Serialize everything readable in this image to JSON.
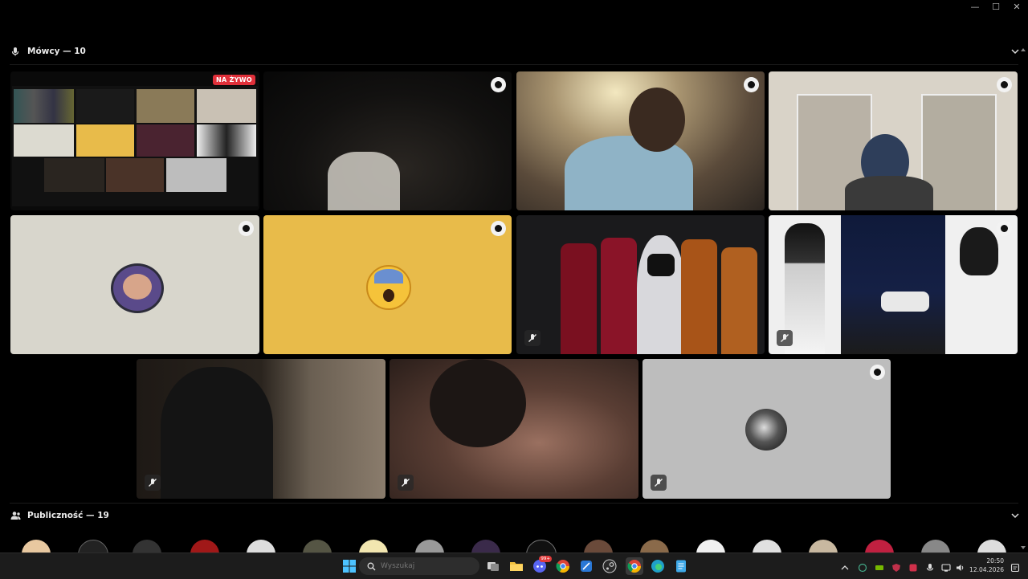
{
  "window": {
    "minimize_label": "—",
    "maximize_label": "☐",
    "close_label": "✕"
  },
  "speakers": {
    "title": "Mówcy — 10",
    "live_badge": "NA ŻYWO"
  },
  "audience": {
    "title": "Publiczność — 19",
    "count_avatars": 19
  },
  "taskbar": {
    "search_placeholder": "Wyszukaj",
    "time": "20:50",
    "date": "12.04.2026",
    "discord_badge": "99+"
  },
  "colors": {
    "background": "#000000",
    "tile_gray": "#d8d6cc",
    "tile_yellow": "#e8bb4a",
    "tile_silver": "#bdbdbd",
    "live_red": "#e0303a",
    "taskbar": "#1c1c1c"
  },
  "icons": {
    "speakers_header": "microphone-icon",
    "audience_header": "people-icon",
    "collapse": "chevron-down-icon",
    "tile_pin": "pin-icon",
    "tile_mute": "muted-mic-icon",
    "taskbar": [
      "windows-start-icon",
      "search-icon",
      "task-view-icon",
      "file-explorer-icon",
      "discord-icon",
      "chrome-icon",
      "snipping-tool-icon",
      "steam-icon",
      "chrome-active-icon",
      "edge-icon",
      "notepad-icon"
    ]
  }
}
